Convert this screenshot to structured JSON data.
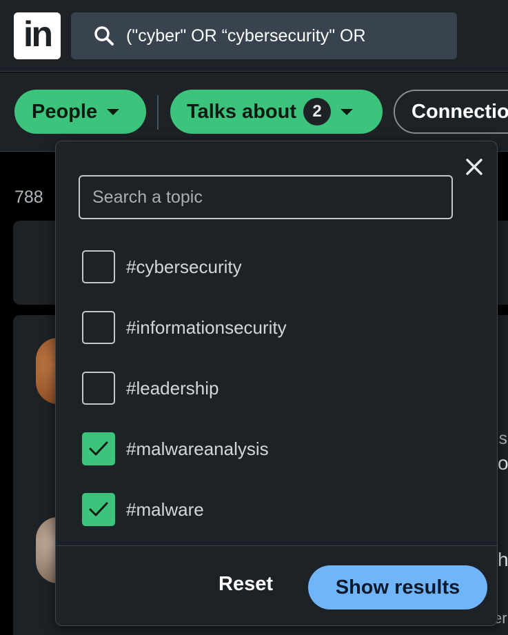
{
  "nav": {
    "logo_text": "in",
    "search_query": "(\"cyber\" OR “cybersecurity\" OR"
  },
  "filters": {
    "people_label": "People",
    "talks_label": "Talks about",
    "talks_count": "2",
    "connections_label": "Connections"
  },
  "background": {
    "results_count": "788",
    "frag_1": "is",
    "frag_2": "o",
    "frag_3": "h",
    "frag_4": "er"
  },
  "topic_dropdown": {
    "search_placeholder": "Search a topic",
    "options": [
      {
        "label": "#cybersecurity",
        "checked": false
      },
      {
        "label": "#informationsecurity",
        "checked": false
      },
      {
        "label": "#leadership",
        "checked": false
      },
      {
        "label": "#malwareanalysis",
        "checked": true
      },
      {
        "label": "#malware",
        "checked": true
      }
    ],
    "reset_label": "Reset",
    "show_results_label": "Show results"
  },
  "colors": {
    "accent_green": "#3cc47c",
    "accent_blue": "#70b5f9",
    "surface": "#1d2226"
  }
}
